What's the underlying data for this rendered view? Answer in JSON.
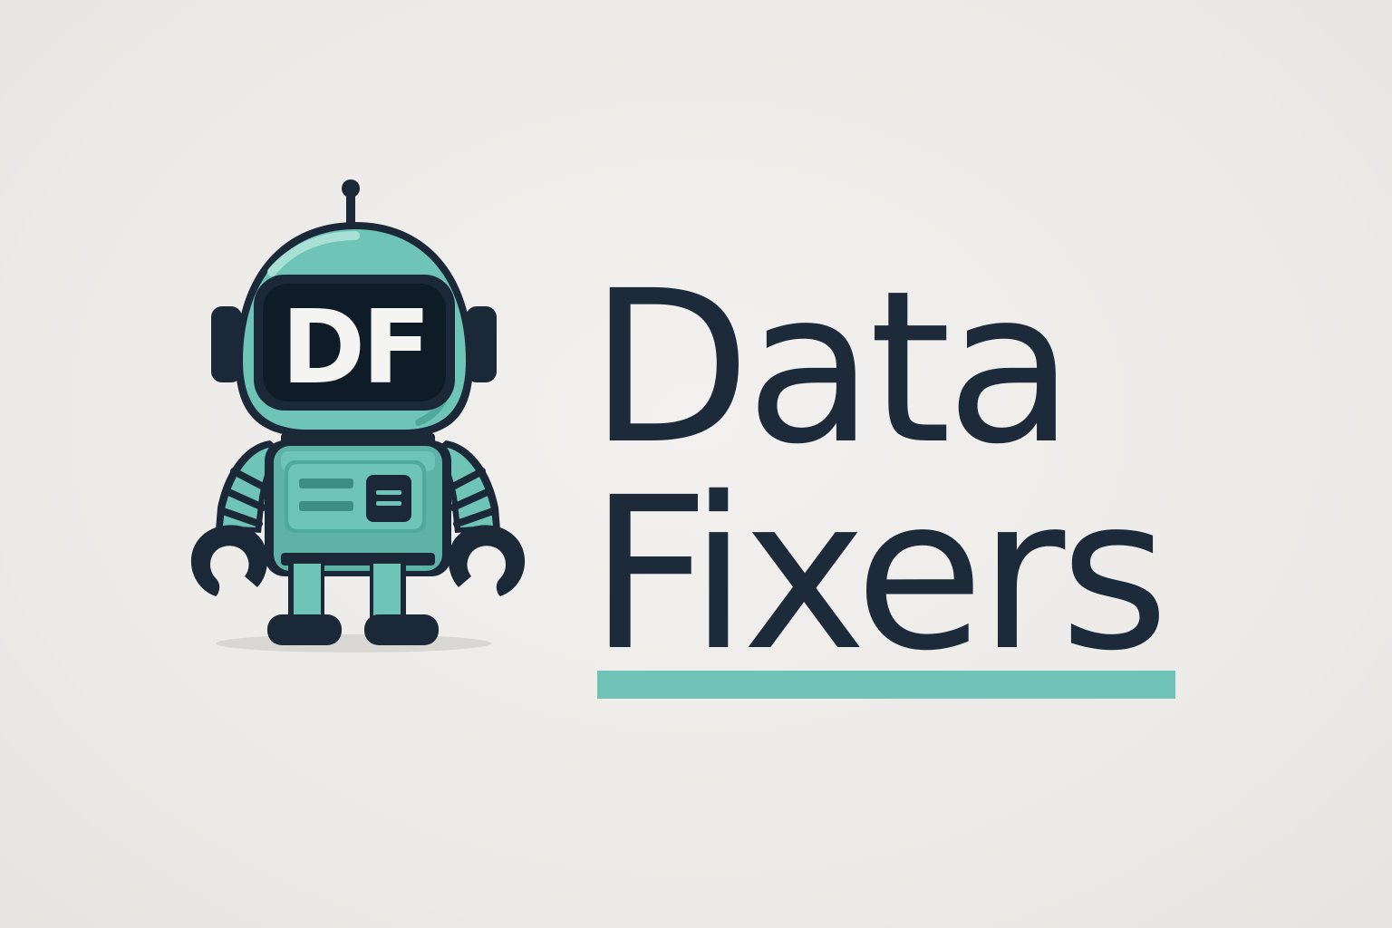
{
  "brand": {
    "name_line_1": "Data",
    "name_line_2": "Fixers",
    "monogram": "DF",
    "colors": {
      "teal": "#6ec4b6",
      "teal_dark": "#4faa9c",
      "navy": "#1b2838",
      "text": "#1d2a3a",
      "accent_bar": "#72c3b7",
      "background": "#eeedeb"
    }
  },
  "mascot": {
    "icon": "robot-mascot-icon"
  }
}
